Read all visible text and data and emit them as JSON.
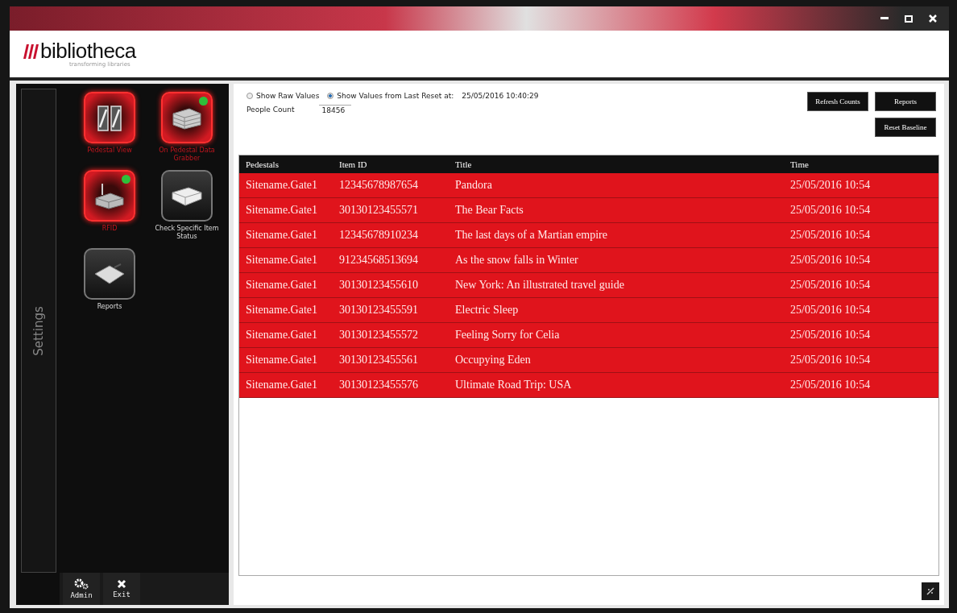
{
  "window": {
    "controls": [
      {
        "kind": "minimize"
      },
      {
        "kind": "maximize"
      },
      {
        "kind": "close"
      }
    ]
  },
  "logo": {
    "name": "bibliotheca",
    "tagline": "transforming libraries"
  },
  "sidebar": {
    "tab": "Settings",
    "tiles": [
      {
        "label": "Pedestal View",
        "kind": "gates",
        "active": true,
        "indicator": false
      },
      {
        "label": "On Pedestal Data Grabber",
        "kind": "books",
        "active": true,
        "indicator": true
      },
      {
        "label": "RFID",
        "kind": "reader",
        "active": true,
        "indicator": true
      },
      {
        "label": "Check Specific Item Status",
        "kind": "book",
        "active": false,
        "indicator": false
      },
      {
        "label": "Reports",
        "kind": "report",
        "active": false,
        "indicator": false
      }
    ],
    "footer": [
      {
        "label": "Admin",
        "kind": "gears"
      },
      {
        "label": "Exit",
        "kind": "close"
      }
    ]
  },
  "options": [
    {
      "label": "Show Raw Values",
      "selected": false
    },
    {
      "label": "Show Values from Last Reset at:",
      "selected": true
    }
  ],
  "reset_time": "25/05/2016 10:40:29",
  "people_count": {
    "label": "People Count",
    "value": "18456"
  },
  "buttons": [
    "Refresh Counts",
    "Reports",
    "Reset Baseline"
  ],
  "table": {
    "columns": [
      "Pedestals",
      "Item ID",
      "Title",
      "Time"
    ],
    "rows": [
      [
        "Sitename.Gate1",
        "12345678987654",
        "Pandora",
        "25/05/2016 10:54"
      ],
      [
        "Sitename.Gate1",
        "30130123455571",
        "The Bear Facts",
        "25/05/2016 10:54"
      ],
      [
        "Sitename.Gate1",
        "12345678910234",
        "The last days of a Martian empire",
        "25/05/2016 10:54"
      ],
      [
        "Sitename.Gate1",
        "91234568513694",
        "As the snow falls in Winter",
        "25/05/2016 10:54"
      ],
      [
        "Sitename.Gate1",
        "30130123455610",
        "New York: An illustrated travel guide",
        "25/05/2016 10:54"
      ],
      [
        "Sitename.Gate1",
        "30130123455591",
        "Electric Sleep",
        "25/05/2016 10:54"
      ],
      [
        "Sitename.Gate1",
        "30130123455572",
        "Feeling Sorry for Celia",
        "25/05/2016 10:54"
      ],
      [
        "Sitename.Gate1",
        "30130123455561",
        "Occupying Eden",
        "25/05/2016 10:54"
      ],
      [
        "Sitename.Gate1",
        "30130123455576",
        "Ultimate Road Trip: USA",
        "25/05/2016 10:54"
      ]
    ]
  }
}
